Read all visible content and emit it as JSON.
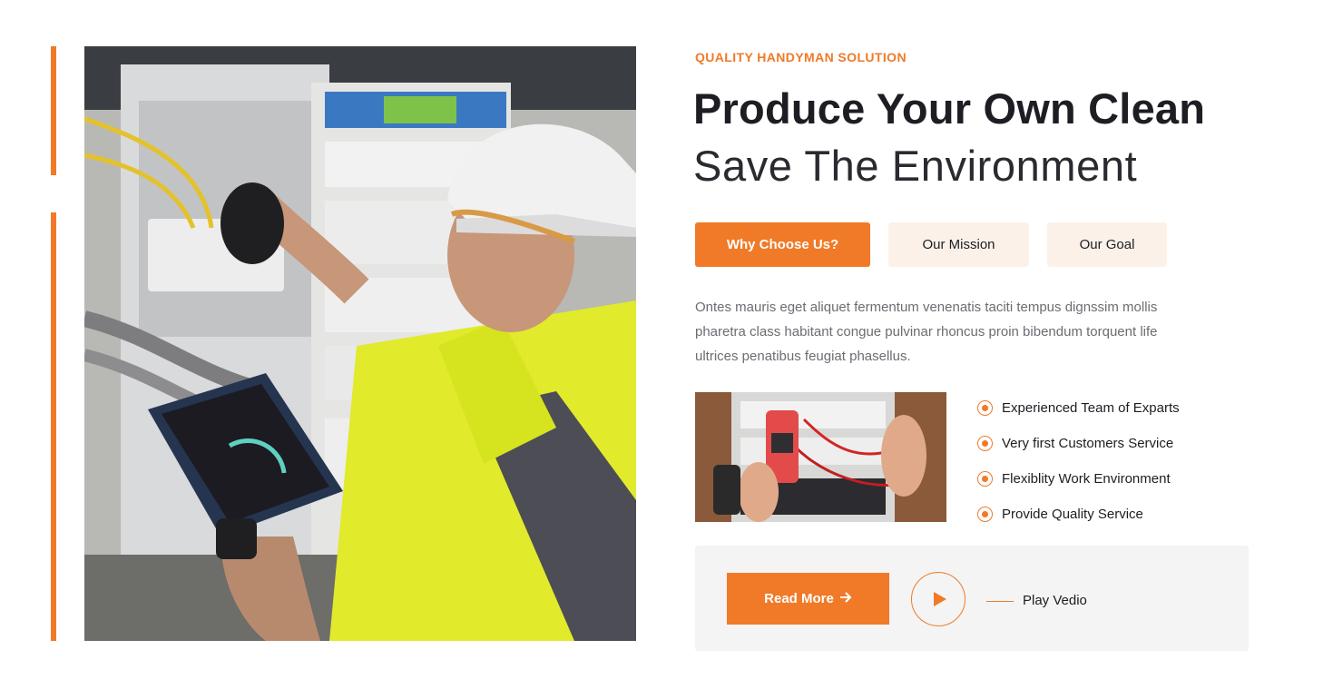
{
  "section": {
    "eyebrow": "QUALITY HANDYMAN SOLUTION",
    "headline_bold": "Produce Your Own Clean",
    "headline_light": "Save The Environment",
    "accent_color": "#f07a28"
  },
  "tabs": [
    {
      "label": "Why Choose Us?",
      "active": true
    },
    {
      "label": "Our Mission",
      "active": false
    },
    {
      "label": "Our Goal",
      "active": false
    }
  ],
  "description": "Ontes mauris eget aliquet fermentum venenatis taciti tempus dignssim mollis pharetra class habitant congue pulvinar rhoncus proin bibendum torquent life ultrices penatibus feugiat phasellus.",
  "features": [
    "Experienced Team of Exparts",
    "Very first Customers Service",
    "Flexiblity Work Environment",
    "Provide Quality Service"
  ],
  "cta": {
    "read_more_label": "Read More",
    "read_more_icon": "arrow-right-icon",
    "play_icon": "play-icon",
    "play_label": "Play Vedio"
  },
  "images": {
    "hero": "electrician-in-hard-hat-with-tablet",
    "thumbnail": "multimeter-on-breaker-panel"
  }
}
